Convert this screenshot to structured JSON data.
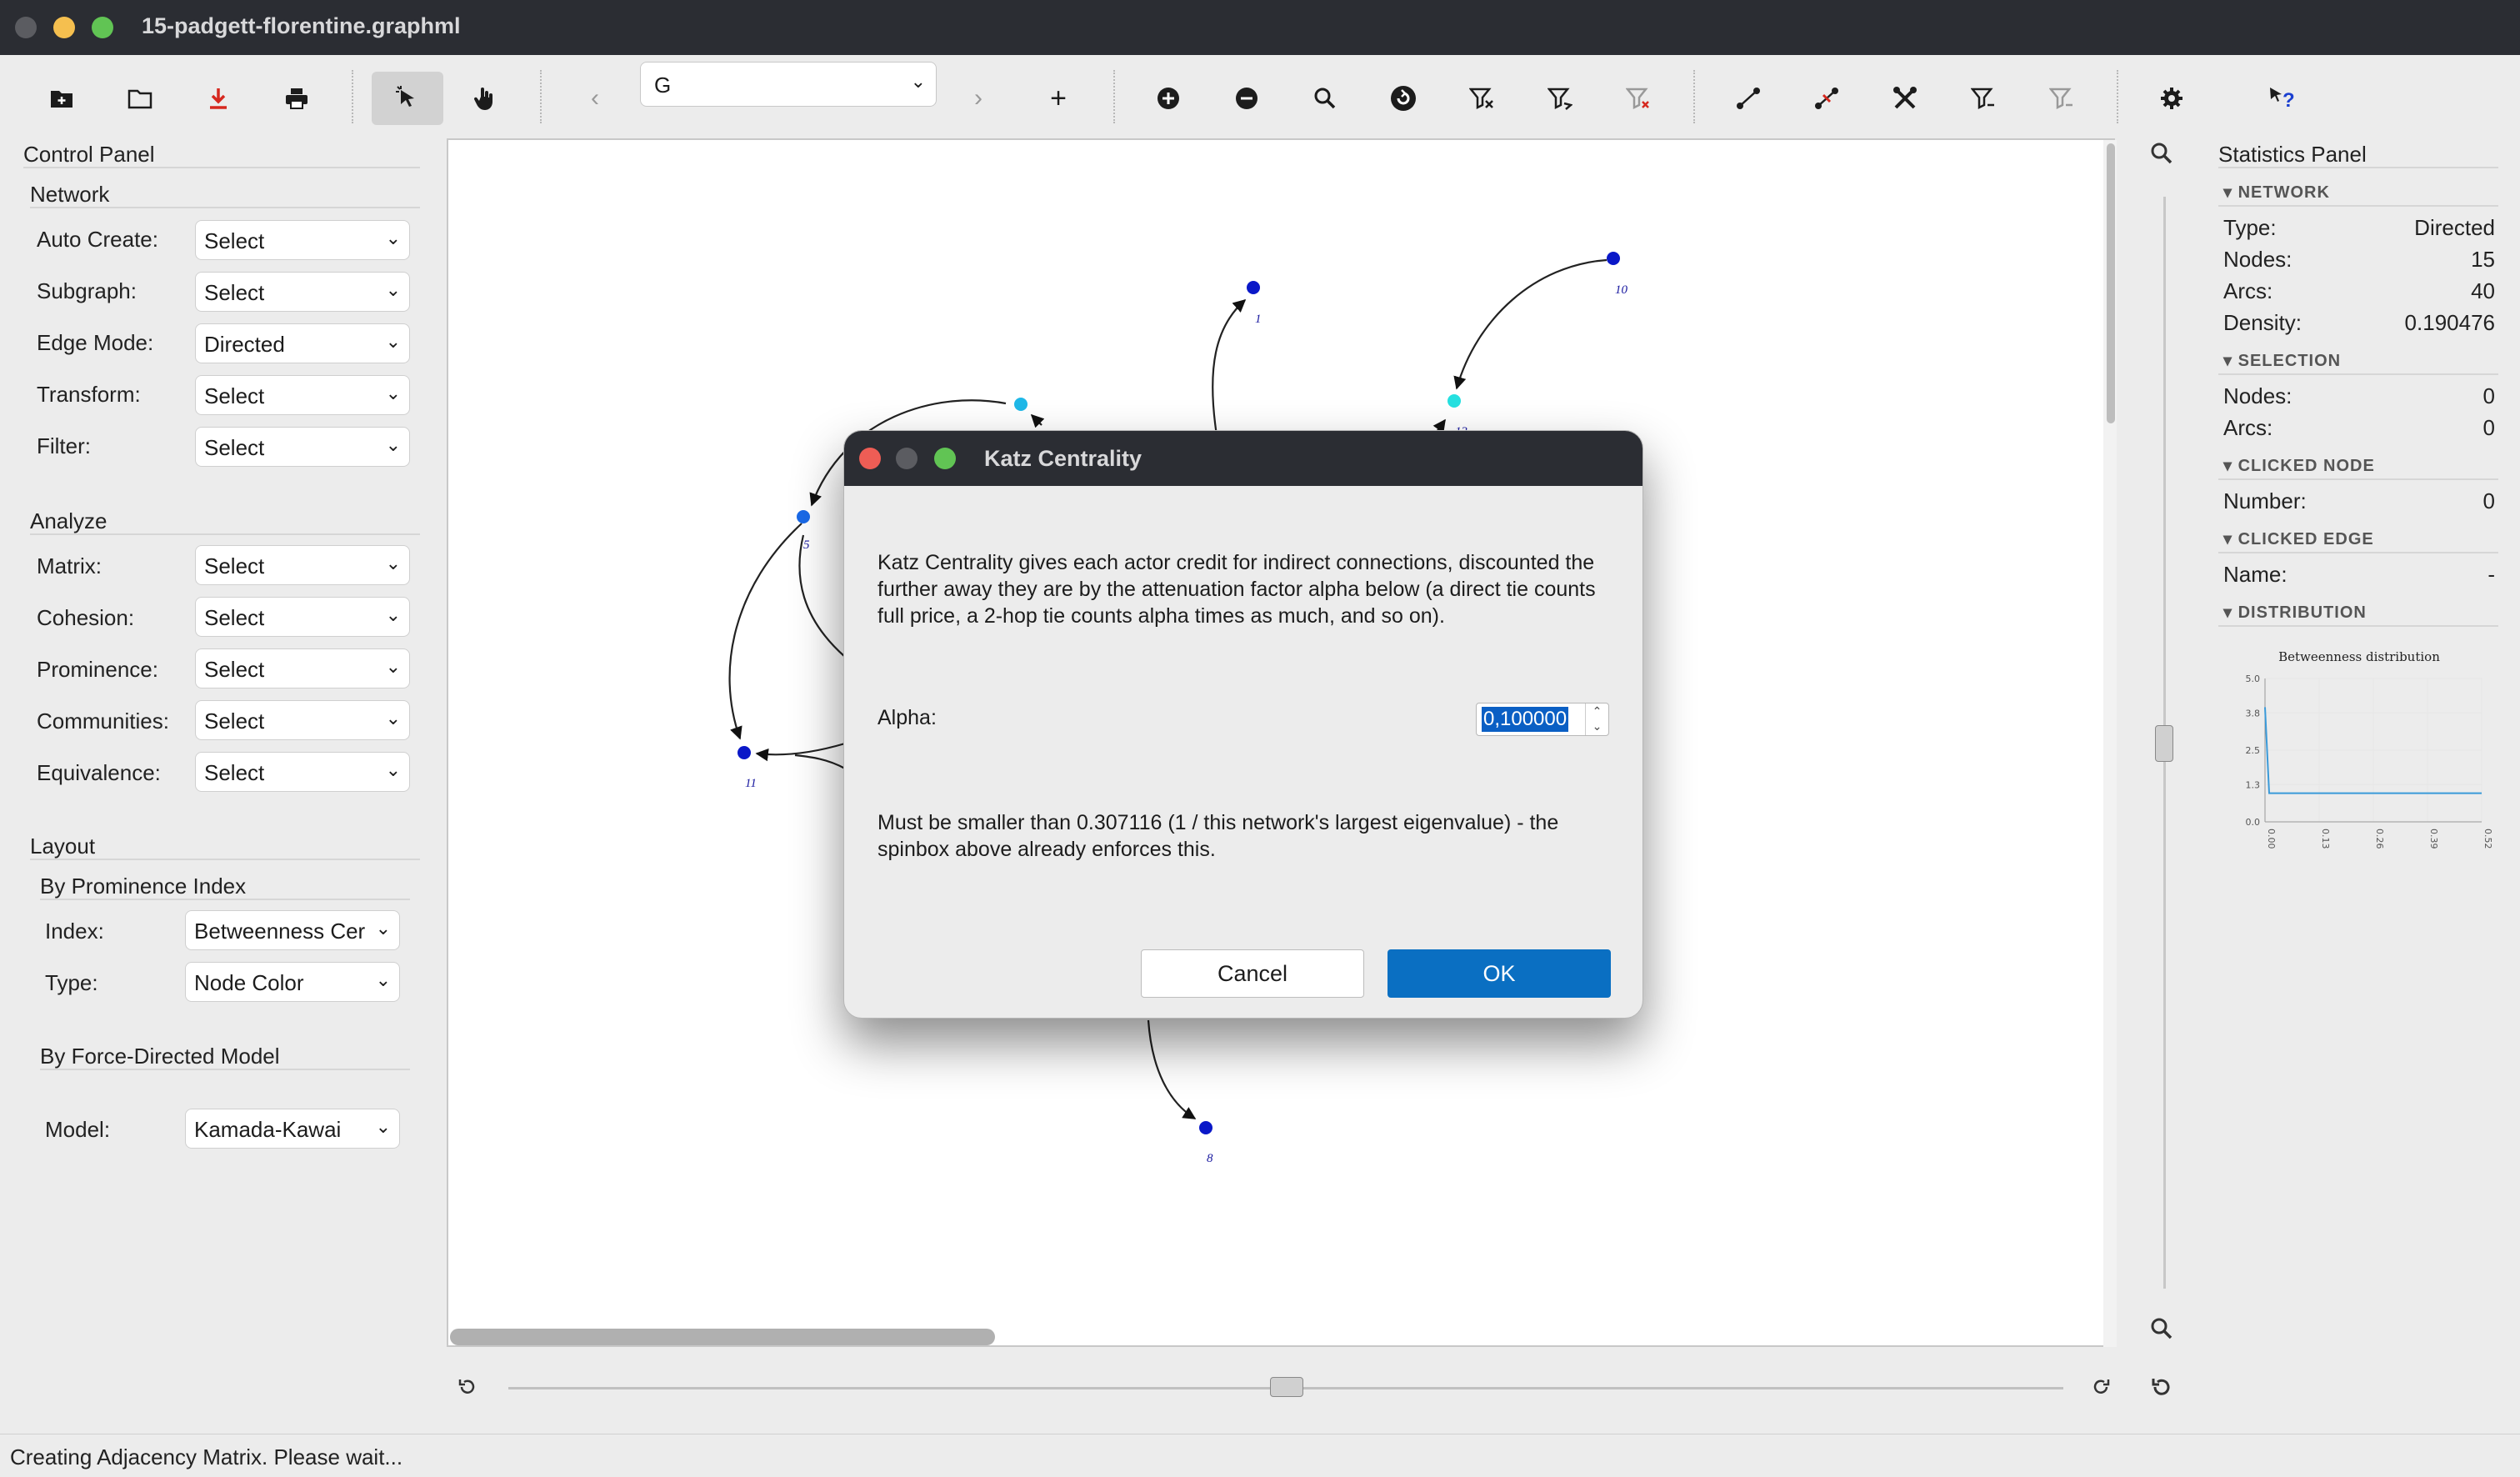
{
  "window": {
    "title": "15-padgett-florentine.graphml"
  },
  "toolbar": {
    "graph_select": "G",
    "buttons": [
      "new-file-icon",
      "open-folder-icon",
      "save-icon",
      "print-icon",
      "select-cursor-icon",
      "hand-pointer-icon",
      "back-arrow-icon",
      "forward-arrow-icon",
      "add-icon",
      "zoom-in-icon",
      "zoom-out-icon",
      "search-icon",
      "rotate-icon",
      "filter-node-icon",
      "filter-edge-icon",
      "filter-disabled-icon",
      "add-edge-icon",
      "remove-edge-icon",
      "tools-icon",
      "filter-2-icon",
      "filter-3-icon",
      "settings-icon",
      "help-icon"
    ]
  },
  "control_panel": {
    "title": "Control Panel",
    "network": {
      "title": "Network",
      "rows": [
        {
          "label": "Auto Create:",
          "value": "Select"
        },
        {
          "label": "Subgraph:",
          "value": "Select"
        },
        {
          "label": "Edge Mode:",
          "value": "Directed"
        },
        {
          "label": "Transform:",
          "value": "Select"
        },
        {
          "label": "Filter:",
          "value": "Select"
        }
      ]
    },
    "analyze": {
      "title": "Analyze",
      "rows": [
        {
          "label": "Matrix:",
          "value": "Select"
        },
        {
          "label": "Cohesion:",
          "value": "Select"
        },
        {
          "label": "Prominence:",
          "value": "Select"
        },
        {
          "label": "Communities:",
          "value": "Select"
        },
        {
          "label": "Equivalence:",
          "value": "Select"
        }
      ]
    },
    "layout": {
      "title": "Layout",
      "prominence_title": "By Prominence Index",
      "index_label": "Index:",
      "index_value": "Betweenness Cer",
      "type_label": "Type:",
      "type_value": "Node Color",
      "force_title": "By Force-Directed Model",
      "model_label": "Model:",
      "model_value": "Kamada-Kawai"
    }
  },
  "graph": {
    "nodes": [
      {
        "label": "1",
        "color": "#0a18c8"
      },
      {
        "label": "10",
        "color": "#0a18c8"
      },
      {
        "label": "11",
        "color": "#0a18c8"
      },
      {
        "label": "8",
        "color": "#0a18c8"
      },
      {
        "label": "",
        "color": "#1fb8e8"
      },
      {
        "label": "13",
        "color": "#25e0e0"
      },
      {
        "label": "5",
        "color": "#1a6ae8"
      }
    ]
  },
  "stats_panel": {
    "title": "Statistics Panel",
    "network": {
      "title": "NETWORK",
      "type_label": "Type:",
      "type_value": "Directed",
      "nodes_label": "Nodes:",
      "nodes_value": "15",
      "arcs_label": "Arcs:",
      "arcs_value": "40",
      "density_label": "Density:",
      "density_value": "0.190476"
    },
    "selection": {
      "title": "SELECTION",
      "nodes_label": "Nodes:",
      "nodes_value": "0",
      "arcs_label": "Arcs:",
      "arcs_value": "0"
    },
    "clicked_node": {
      "title": "CLICKED NODE",
      "number_label": "Number:",
      "number_value": "0"
    },
    "clicked_edge": {
      "title": "CLICKED EDGE",
      "name_label": "Name:",
      "name_value": "-"
    },
    "distribution": {
      "title": "DISTRIBUTION"
    }
  },
  "chart_data": {
    "type": "line",
    "title": "Betweenness distribution",
    "x": [
      0.0,
      0.01,
      0.13,
      0.26,
      0.39,
      0.52
    ],
    "values": [
      4.0,
      1.0,
      1.0,
      1.0,
      1.0,
      1.0
    ],
    "xticks": [
      "0.00",
      "0.13",
      "0.26",
      "0.39",
      "0.52"
    ],
    "yticks": [
      "0.0",
      "1.3",
      "2.5",
      "3.8",
      "5.0"
    ],
    "ylim": [
      0,
      5
    ],
    "xlim": [
      0,
      0.52
    ],
    "grid": true,
    "color": "#3a9ad9"
  },
  "dialog": {
    "title": "Katz Centrality",
    "description": "Katz Centrality gives each actor credit for indirect connections, discounted the further away they are by the attenuation factor alpha below (a direct tie counts full price, a 2-hop tie counts alpha times as much, and so on).",
    "alpha_label": "Alpha:",
    "alpha_value": "0,100000",
    "note": "Must be smaller than 0.307116 (1 / this network's largest eigenvalue) - the spinbox above already enforces this.",
    "cancel_label": "Cancel",
    "ok_label": "OK"
  },
  "status": {
    "text": "Creating Adjacency Matrix.  Please wait..."
  }
}
